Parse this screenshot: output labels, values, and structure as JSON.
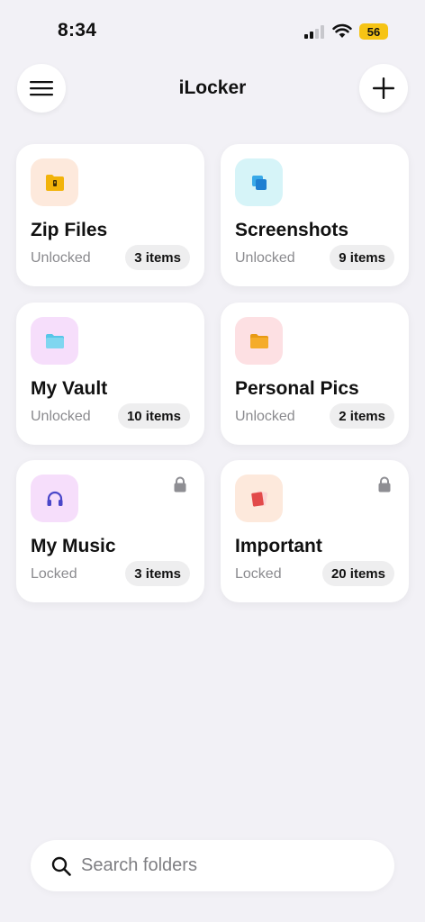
{
  "status_bar": {
    "time": "8:34",
    "battery": "56"
  },
  "header": {
    "title": "iLocker",
    "menu_icon": "hamburger-menu-icon",
    "add_icon": "plus-icon"
  },
  "folders": [
    {
      "name": "Zip Files",
      "status": "Unlocked",
      "count": "3 items",
      "icon": "zip-folder-icon",
      "icon_bg": "#fde9dc",
      "locked": false
    },
    {
      "name": "Screenshots",
      "status": "Unlocked",
      "count": "9 items",
      "icon": "screenshots-icon",
      "icon_bg": "#d6f4f8",
      "locked": false
    },
    {
      "name": "My Vault",
      "status": "Unlocked",
      "count": "10 items",
      "icon": "folder-icon",
      "icon_bg": "#f6defb",
      "locked": false
    },
    {
      "name": "Personal Pics",
      "status": "Unlocked",
      "count": "2 items",
      "icon": "folder-icon",
      "icon_bg": "#fde0e3",
      "locked": false
    },
    {
      "name": "My Music",
      "status": "Locked",
      "count": "3 items",
      "icon": "headphones-icon",
      "icon_bg": "#f6defb",
      "locked": true
    },
    {
      "name": "Important",
      "status": "Locked",
      "count": "20 items",
      "icon": "important-doc-icon",
      "icon_bg": "#fde9dc",
      "locked": true
    }
  ],
  "search": {
    "placeholder": "Search folders",
    "value": ""
  },
  "colors": {
    "background": "#f2f1f6",
    "card": "#ffffff",
    "battery": "#f6c415",
    "muted_text": "#8a8a8e"
  }
}
